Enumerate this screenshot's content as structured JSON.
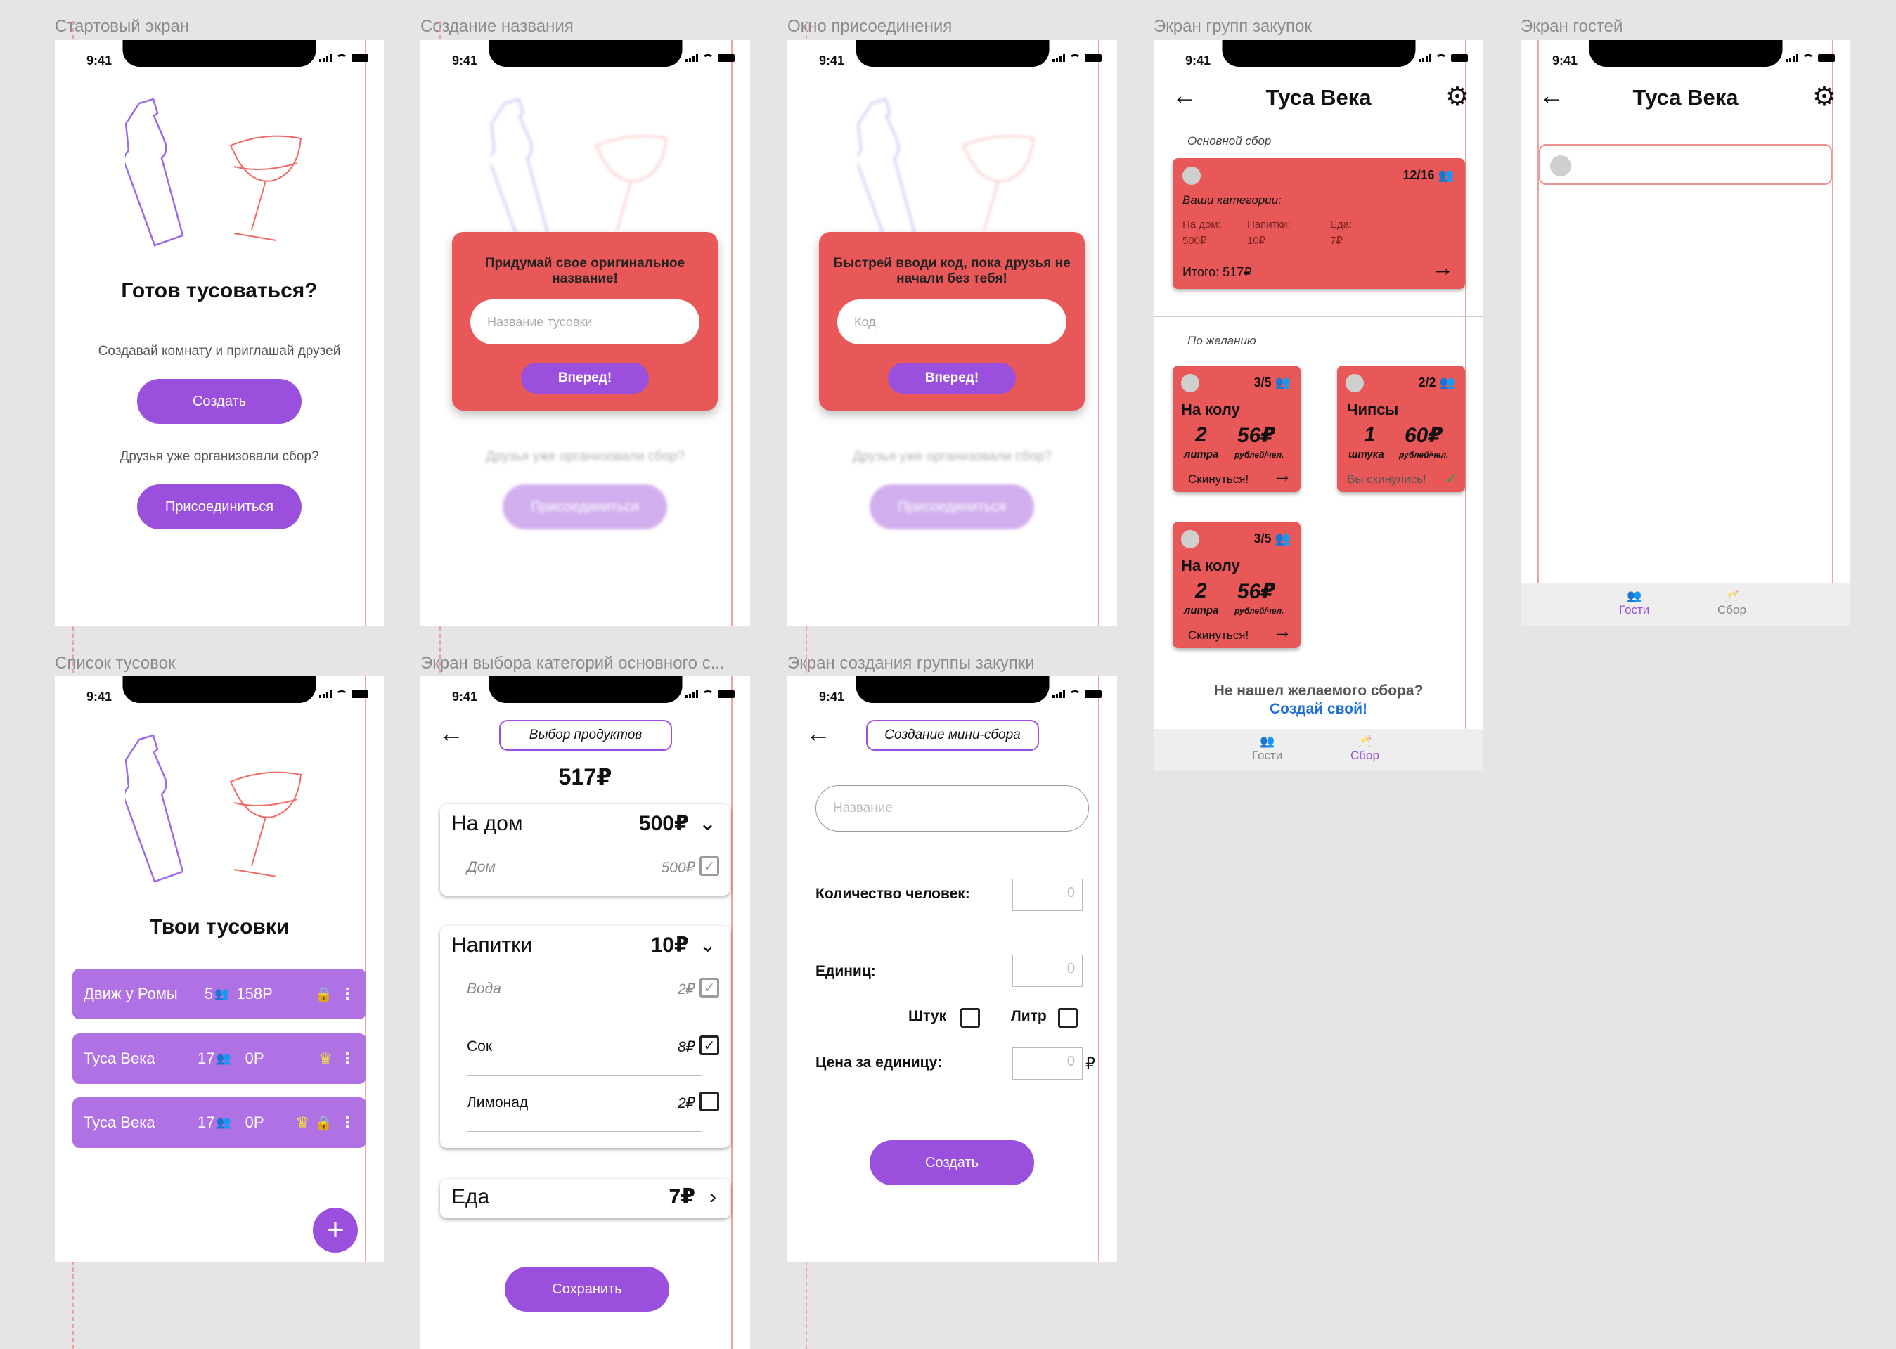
{
  "status_time": "9:41",
  "frames": {
    "start": "Стартовый экран",
    "name": "Создание названия",
    "join": "Окно присоединения",
    "groups": "Экран групп закупок",
    "guests": "Экран гостей",
    "list": "Список тусовок",
    "categories": "Экран выбора категорий основного с...",
    "create_group": "Экран создания группы закупки"
  },
  "start": {
    "title": "Готов тусоваться?",
    "subtitle": "Создавай комнату и приглашай друзей",
    "create_btn": "Создать",
    "friends_text": "Друзья уже организовали сбор?",
    "join_btn": "Присоединиться"
  },
  "name_modal": {
    "title": "Придумай свое оригинальное название!",
    "placeholder": "Название тусовки",
    "btn": "Вперед!"
  },
  "join_modal": {
    "title": "Быстрей вводи код, пока друзья не начали без тебя!",
    "placeholder": "Код",
    "btn": "Вперед!"
  },
  "list": {
    "title": "Твои тусовки",
    "items": [
      {
        "name": "Движ у Ромы",
        "count": "5",
        "sum": "158Р"
      },
      {
        "name": "Туса Века",
        "count": "17",
        "sum": "0Р"
      },
      {
        "name": "Туса Века",
        "count": "17",
        "sum": "0Р"
      }
    ],
    "fab": "+"
  },
  "categories": {
    "pill": "Выбор продуктов",
    "total": "517₽",
    "home": {
      "title": "На дом",
      "sum": "500₽",
      "items": [
        {
          "name": "Дом",
          "price": "500₽",
          "checked": true
        }
      ]
    },
    "drinks": {
      "title": "Напитки",
      "sum": "10₽",
      "items": [
        {
          "name": "Вода",
          "price": "2₽",
          "checked": true
        },
        {
          "name": "Сок",
          "price": "8₽",
          "checked": true
        },
        {
          "name": "Лимонад",
          "price": "2₽",
          "checked": false
        }
      ]
    },
    "food": {
      "title": "Еда",
      "sum": "7₽"
    },
    "save_btn": "Сохранить"
  },
  "create_group": {
    "pill": "Создание мини-сбора",
    "name_placeholder": "Название",
    "people_label": "Количество человек:",
    "people_value": "0",
    "units_label": "Единиц:",
    "units_value": "0",
    "pcs_label": "Штук",
    "liter_label": "Литр",
    "price_label": "Цена за единицу:",
    "price_value": "0",
    "currency": "₽",
    "btn": "Создать"
  },
  "groups": {
    "title": "Туса Века",
    "main_label": "Основной сбор",
    "main_card": {
      "count": "12/16",
      "heading": "Ваши категории:",
      "cat1": "На дом:",
      "cat1_val": "500₽",
      "cat2": "Напитки:",
      "cat2_val": "10₽",
      "cat3": "Еда:",
      "cat3_val": "7₽",
      "total": "Итого: 517₽"
    },
    "optional_label": "По желанию",
    "cards": [
      {
        "count": "3/5",
        "name": "На колу",
        "qty": "2",
        "qty_unit": "литра",
        "price": "56₽",
        "price_unit": "рублей/чел.",
        "action": "Скинуться!"
      },
      {
        "count": "2/2",
        "name": "Чипсы",
        "qty": "1",
        "qty_unit": "штука",
        "price": "60₽",
        "price_unit": "рублей/чел.",
        "action": "Вы скинулись!"
      },
      {
        "count": "3/5",
        "name": "На колу",
        "qty": "2",
        "qty_unit": "литра",
        "price": "56₽",
        "price_unit": "рублей/чел.",
        "action": "Скинуться!"
      }
    ],
    "not_found": "Не нашел желаемого сбора?",
    "create_own": "Создай свой!",
    "tab_guests": "Гости",
    "tab_collect": "Сбор"
  },
  "guests": {
    "title": "Туса Века",
    "tab_guests": "Гости",
    "tab_collect": "Сбор"
  },
  "colors": {
    "accent": "#9b4fdd",
    "card": "#e85858",
    "list_item": "#b071e4",
    "link": "#1e6fd9"
  }
}
